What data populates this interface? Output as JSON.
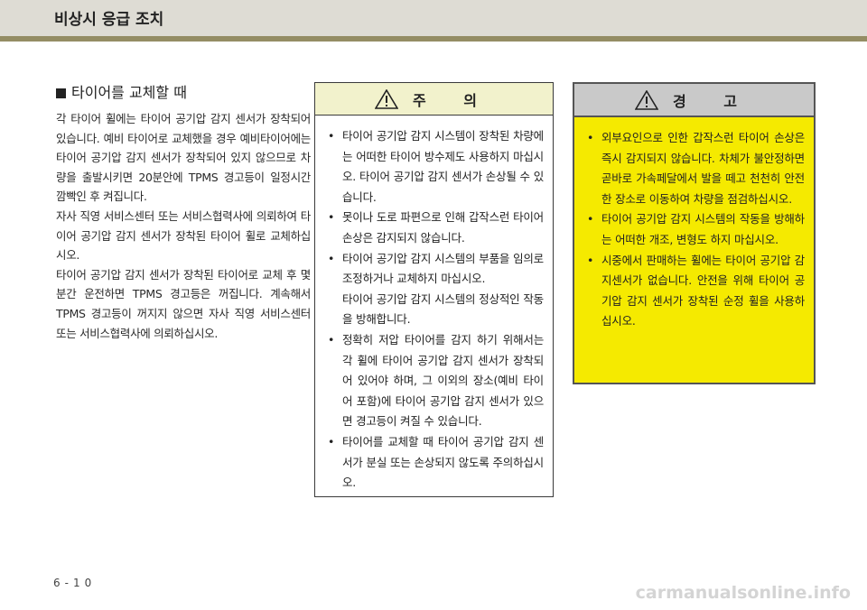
{
  "header": {
    "title": "비상시 응급 조치"
  },
  "section": {
    "heading": "타이어를 교체할 때",
    "paragraphs": [
      "각 타이어 휠에는 타이어 공기압 감지 센서가 장착되어 있습니다. 예비 타이어로 교체했을 경우 예비타이어에는 타이어 공기압 감지 센서가 장착되어 있지 않으므로 차량을 출발시키면 20분안에 TPMS 경고등이 일정시간 깜빡인 후 켜집니다.",
      "자사 직영 서비스센터 또는 서비스협력사에 의뢰하여 타이어 공기압 감지 센서가 장착된 타이어 휠로 교체하십시오.",
      "타이어 공기압 감지 센서가 장착된 타이어로 교체 후 몇 분간 운전하면 TPMS 경고등은 꺼집니다. 계속해서 TPMS 경고등이 꺼지지 않으면 자사 직영 서비스센터 또는 서비스협력사에 의뢰하십시오."
    ]
  },
  "caution": {
    "title": "주 의",
    "icon": "warning-triangle-icon",
    "items": [
      {
        "bullet": "•",
        "text": "타이어 공기압 감지 시스템이 장착된 차량에는 어떠한 타이어 방수제도 사용하지 마십시오. 타이어 공기압 감지 센서가 손상될 수 있습니다."
      },
      {
        "bullet": "•",
        "text": "못이나 도로 파편으로 인해 갑작스런 타이어 손상은 감지되지 않습니다."
      },
      {
        "bullet": "•",
        "text": "타이어 공기압 감지 시스템의 부품을 임의로 조정하거나 교체하지 마십시오."
      },
      {
        "bullet": "",
        "text": "타이어 공기압 감지 시스템의 정상적인 작동을 방해합니다."
      },
      {
        "bullet": "•",
        "text": "정확히 저압 타이어를 감지 하기 위해서는 각 휠에 타이어 공기압 감지 센서가 장착되어 있어야 하며, 그 이외의 장소(예비 타이어 포함)에 타이어 공기압 감지 센서가 있으면 경고등이 켜질 수 있습니다."
      },
      {
        "bullet": "•",
        "text": "타이어를 교체할 때 타이어 공기압 감지 센서가 분실 또는 손상되지 않도록 주의하십시오."
      }
    ]
  },
  "warning": {
    "title": "경 고",
    "icon": "warning-triangle-icon",
    "items": [
      {
        "bullet": "•",
        "text": "외부요인으로 인한 갑작스런 타이어 손상은 즉시 감지되지 않습니다. 차체가 불안정하면 곧바로 가속페달에서 발을 떼고 천천히 안전한 장소로 이동하여 차량을 점검하십시오."
      },
      {
        "bullet": "•",
        "text": "타이어 공기압 감지 시스템의 작동을 방해하는 어떠한 개조, 변형도 하지 마십시오."
      },
      {
        "bullet": "•",
        "text": "시중에서 판매하는 휠에는 타이어 공기압 감지센서가 없습니다. 안전을 위해 타이어 공기압 감지 센서가 장착된 순정 휠을 사용하십시오."
      }
    ]
  },
  "footer": {
    "page_number": "6-10",
    "watermark": "carmanualsonline.info"
  },
  "colors": {
    "header_bg": "#dedcd4",
    "header_rule": "#948d64",
    "caution_head": "#f2f2cc",
    "warning_bg": "#f5ea00",
    "warning_head": "#c9c9c9"
  }
}
